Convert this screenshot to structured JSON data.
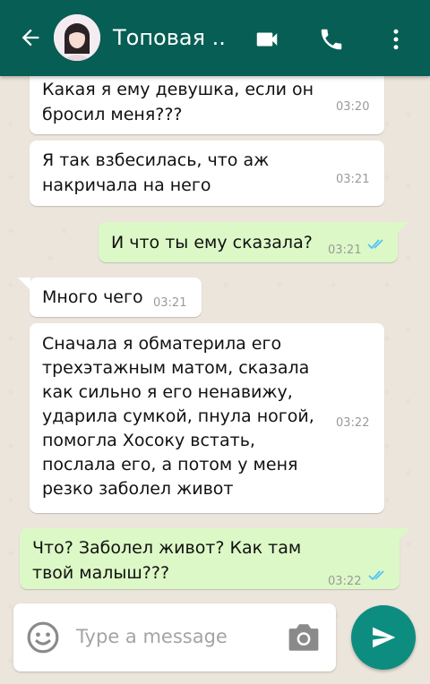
{
  "header": {
    "title": "Топовая ..",
    "back_icon": "arrow-left-icon",
    "video_icon": "videocam-icon",
    "call_icon": "phone-icon",
    "more_icon": "more-vert-icon"
  },
  "messages": [
    {
      "direction": "in",
      "text": "Какая я ему девушка, если он\nбросил меня???",
      "time": "03:20"
    },
    {
      "direction": "in",
      "text": "Я так взбесилась, что аж\nнакричала на него",
      "time": "03:21"
    },
    {
      "direction": "out",
      "text": "И что ты ему сказала?",
      "time": "03:21",
      "read": true
    },
    {
      "direction": "in",
      "text": "Много чего",
      "time": "03:21"
    },
    {
      "direction": "in",
      "text": "Сначала я обматерила его\nтрехэтажным матом, сказала\nкак сильно я его ненавижу,\nударила сумкой, пнула ногой,\nпомогла Хосоку встать,\nпослала его, а потом у меня\nрезко заболел живот",
      "time": "03:22"
    },
    {
      "direction": "out",
      "text": "Что? Заболел живот? Как там\nтвой малыш???",
      "time": "03:22",
      "read": true
    }
  ],
  "composer": {
    "placeholder": "Type a message",
    "emoji_icon": "emoji-icon",
    "camera_icon": "camera-icon",
    "send_icon": "send-icon"
  },
  "colors": {
    "header": "#075e54",
    "outgoing_bubble": "#dcf8c6",
    "incoming_bubble": "#ffffff",
    "send_button": "#0c8d7f",
    "read_tick": "#4fc3f7"
  }
}
